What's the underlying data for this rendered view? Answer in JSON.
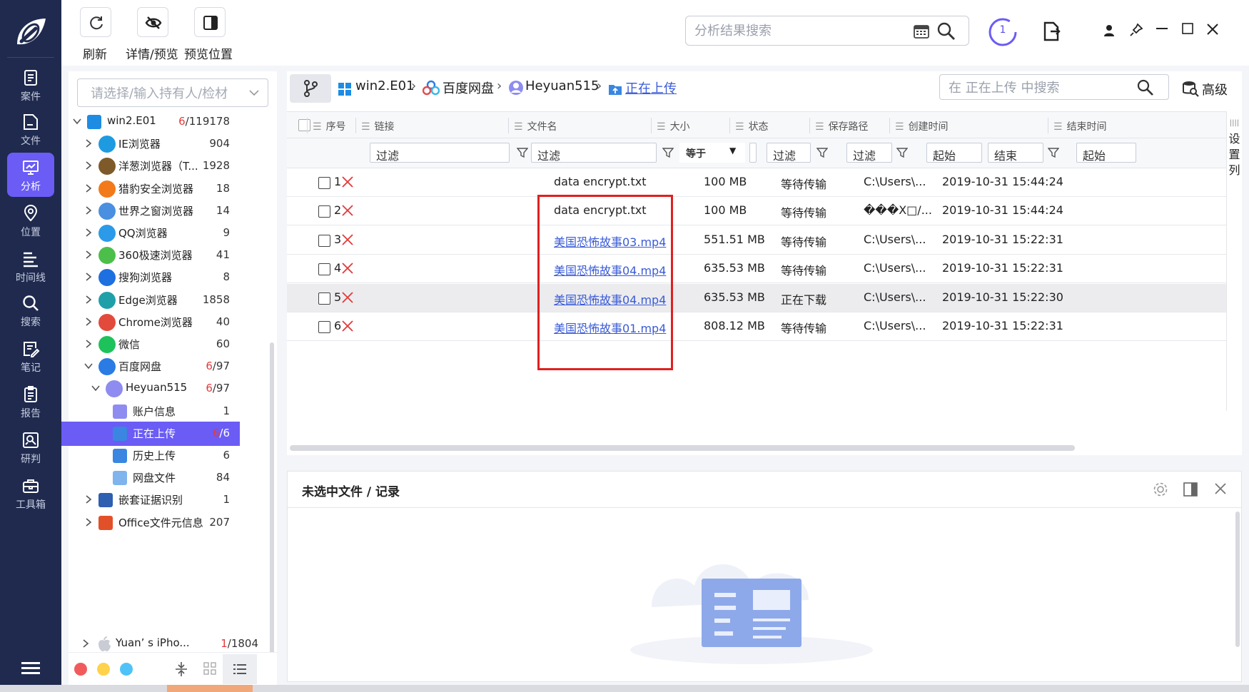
{
  "sidebar": {
    "items": [
      {
        "label": "案件",
        "icon": "case-icon"
      },
      {
        "label": "文件",
        "icon": "file-icon"
      },
      {
        "label": "分析",
        "icon": "analysis-icon"
      },
      {
        "label": "位置",
        "icon": "location-icon"
      },
      {
        "label": "时间线",
        "icon": "timeline-icon"
      },
      {
        "label": "搜索",
        "icon": "search-icon"
      },
      {
        "label": "笔记",
        "icon": "note-icon"
      },
      {
        "label": "报告",
        "icon": "report-icon"
      },
      {
        "label": "研判",
        "icon": "judge-icon"
      },
      {
        "label": "工具箱",
        "icon": "toolbox-icon"
      }
    ],
    "active_index": 2
  },
  "toolbar": {
    "refresh_label": "刷新",
    "detail_label": "详情/预览",
    "preview_pos_label": "预览位置"
  },
  "top_search": {
    "placeholder": "分析结果搜索"
  },
  "task_count": "1",
  "tree": {
    "filter_placeholder": "请选择/输入持有人/检材",
    "rows": [
      {
        "label": "win2.E01",
        "count": "6/119178",
        "count_red": "6",
        "count_rest": "/119178",
        "level": 0,
        "expanded": true
      },
      {
        "label": "IE浏览器",
        "count": "904",
        "level": 1
      },
      {
        "label": "洋葱浏览器（T...",
        "count": "1928",
        "level": 1
      },
      {
        "label": "猎豹安全浏览器",
        "count": "18",
        "level": 1
      },
      {
        "label": "世界之窗浏览器",
        "count": "14",
        "level": 1
      },
      {
        "label": "QQ浏览器",
        "count": "9",
        "level": 1
      },
      {
        "label": "360极速浏览器",
        "count": "41",
        "level": 1
      },
      {
        "label": "搜狗浏览器",
        "count": "8",
        "level": 1
      },
      {
        "label": "Edge浏览器",
        "count": "1858",
        "level": 1
      },
      {
        "label": "Chrome浏览器",
        "count": "40",
        "level": 1
      },
      {
        "label": "微信",
        "count": "60",
        "level": 1
      },
      {
        "label": "百度网盘",
        "count_red": "6",
        "count_rest": "/97",
        "level": 1,
        "expanded": true
      },
      {
        "label": "Heyuan515",
        "count_red": "6",
        "count_rest": "/97",
        "level": 2,
        "expanded": true
      },
      {
        "label": "账户信息",
        "count": "1",
        "level": 3
      },
      {
        "label": "正在上传",
        "count_red": "6",
        "count_rest": "/6",
        "level": 3,
        "selected": true
      },
      {
        "label": "历史上传",
        "count": "6",
        "level": 3
      },
      {
        "label": "网盘文件",
        "count": "84",
        "level": 3
      },
      {
        "label": "嵌套证据识别",
        "count": "1",
        "level": 1
      },
      {
        "label": "Office文件元信息",
        "count": "207",
        "level": 1
      }
    ],
    "device": {
      "label": "Yuan’ s iPho...",
      "count_red": "1",
      "count_rest": "/1804"
    }
  },
  "breadcrumb": {
    "items": [
      "win2.E01",
      "百度网盘",
      "Heyuan515",
      "正在上传"
    ],
    "search_placeholder": "在 正在上传 中搜索",
    "advanced_label": "高级"
  },
  "table": {
    "headers": [
      "序号",
      "链接",
      "文件名",
      "大小",
      "状态",
      "保存路径",
      "创建时间",
      "结束时间"
    ],
    "filters": {
      "text": "过滤",
      "equals": "等于",
      "start": "起始",
      "end": "结束"
    },
    "rows": [
      {
        "idx": "1",
        "name": "data encrypt.txt",
        "size": "100 MB",
        "status": "等待传输",
        "path": "C:\\Users\\...",
        "created": "2019-10-31 15:44:24",
        "link": false
      },
      {
        "idx": "2",
        "name": "data encrypt.txt",
        "size": "100 MB",
        "status": "等待传输",
        "path": "���X□/...",
        "created": "2019-10-31 15:44:24",
        "link": false
      },
      {
        "idx": "3",
        "name": "美国恐怖故事03.mp4",
        "size": "551.51 MB",
        "status": "等待传输",
        "path": "C:\\Users\\...",
        "created": "2019-10-31 15:22:31",
        "link": true
      },
      {
        "idx": "4",
        "name": "美国恐怖故事04.mp4",
        "size": "635.53 MB",
        "status": "等待传输",
        "path": "C:\\Users\\...",
        "created": "2019-10-31 15:22:31",
        "link": true
      },
      {
        "idx": "5",
        "name": "美国恐怖故事04.mp4",
        "size": "635.53 MB",
        "status": "正在下载",
        "path": "C:\\Users\\...",
        "created": "2019-10-31 15:22:30",
        "link": true
      },
      {
        "idx": "6",
        "name": "美国恐怖故事01.mp4",
        "size": "808.12 MB",
        "status": "等待传输",
        "path": "C:\\Users\\...",
        "created": "2019-10-31 15:22:31",
        "link": true
      }
    ],
    "highlighted_row": 4,
    "settings_label": "设置列"
  },
  "detail": {
    "title": "未选中文件 / 记录"
  }
}
